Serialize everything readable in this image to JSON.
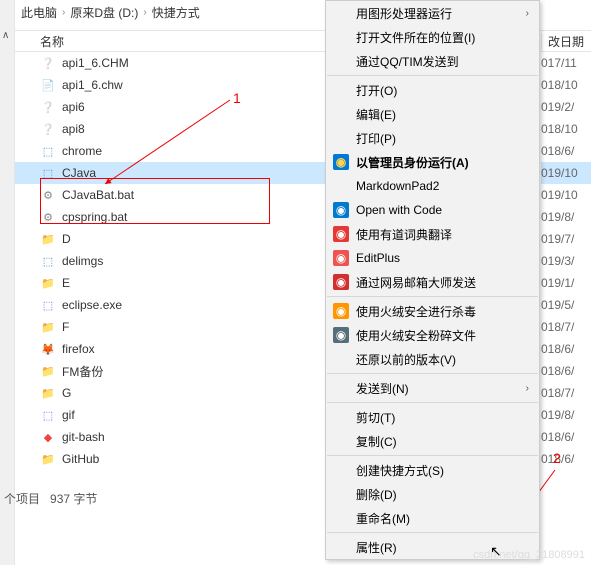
{
  "breadcrumb": {
    "a": "此电脑",
    "b": "原来D盘 (D:)",
    "c": "快捷方式"
  },
  "columns": {
    "name": "名称",
    "date": "改日期"
  },
  "files": [
    {
      "name": "api1_6.CHM",
      "icon": "chm",
      "date": "017/11"
    },
    {
      "name": "api1_6.chw",
      "icon": "doc",
      "date": "018/10"
    },
    {
      "name": "api6",
      "icon": "chm",
      "date": "019/2/"
    },
    {
      "name": "api8",
      "icon": "chm",
      "date": "018/10"
    },
    {
      "name": "chrome",
      "icon": "exe",
      "date": "018/6/"
    },
    {
      "name": "CJava",
      "icon": "exe",
      "date": "019/10",
      "selected": true
    },
    {
      "name": "CJavaBat.bat",
      "icon": "bat",
      "date": "019/10"
    },
    {
      "name": "cpspring.bat",
      "icon": "bat",
      "date": "019/8/"
    },
    {
      "name": "D",
      "icon": "folder",
      "date": "019/7/"
    },
    {
      "name": "delimgs",
      "icon": "exe",
      "date": "019/3/"
    },
    {
      "name": "E",
      "icon": "folder",
      "date": "019/1/"
    },
    {
      "name": "eclipse.exe",
      "icon": "exe",
      "date": "019/5/"
    },
    {
      "name": "F",
      "icon": "folder",
      "date": "018/7/"
    },
    {
      "name": "firefox",
      "icon": "fx",
      "date": "018/6/"
    },
    {
      "name": "FM备份",
      "icon": "folder",
      "date": "018/6/"
    },
    {
      "name": "G",
      "icon": "folder",
      "date": "018/7/"
    },
    {
      "name": "gif",
      "icon": "exe",
      "date": "019/8/"
    },
    {
      "name": "git-bash",
      "icon": "git",
      "date": "018/6/"
    },
    {
      "name": "GitHub",
      "icon": "folder",
      "date": "018/6/"
    }
  ],
  "status": {
    "items": "个项目",
    "size": "937 字节"
  },
  "annotations": {
    "one": "1",
    "two": "2"
  },
  "menu": [
    {
      "label": "用图形处理器运行",
      "sub": true
    },
    {
      "label": "打开文件所在的位置(I)"
    },
    {
      "label": "通过QQ/TIM发送到"
    },
    {
      "sep": true
    },
    {
      "label": "打开(O)"
    },
    {
      "label": "编辑(E)"
    },
    {
      "label": "打印(P)"
    },
    {
      "label": "以管理员身份运行(A)",
      "bold": true,
      "icon": "shield",
      "iconbg": "#0078d7",
      "iconfg": "#ffd54a"
    },
    {
      "label": "MarkdownPad2"
    },
    {
      "label": "Open with Code",
      "icon": "vs",
      "iconbg": "#007acc",
      "iconfg": "#fff"
    },
    {
      "label": "使用有道词典翻译",
      "icon": "yd",
      "iconbg": "#e53935",
      "iconfg": "#fff"
    },
    {
      "label": "EditPlus",
      "icon": "ep",
      "iconbg": "#ef5350",
      "iconfg": "#fff"
    },
    {
      "label": "通过网易邮箱大师发送",
      "icon": "wy",
      "iconbg": "#d32f2f",
      "iconfg": "#fff"
    },
    {
      "sep": true
    },
    {
      "label": "使用火绒安全进行杀毒",
      "icon": "hr",
      "iconbg": "#ff9800",
      "iconfg": "#fff"
    },
    {
      "label": "使用火绒安全粉碎文件",
      "icon": "hr2",
      "iconbg": "#546e7a",
      "iconfg": "#fff"
    },
    {
      "label": "还原以前的版本(V)"
    },
    {
      "sep": true
    },
    {
      "label": "发送到(N)",
      "sub": true
    },
    {
      "sep": true
    },
    {
      "label": "剪切(T)"
    },
    {
      "label": "复制(C)"
    },
    {
      "sep": true
    },
    {
      "label": "创建快捷方式(S)"
    },
    {
      "label": "删除(D)"
    },
    {
      "label": "重命名(M)"
    },
    {
      "sep": true
    },
    {
      "label": "属性(R)"
    }
  ],
  "watermark": "csdn.net/qq_21808991"
}
